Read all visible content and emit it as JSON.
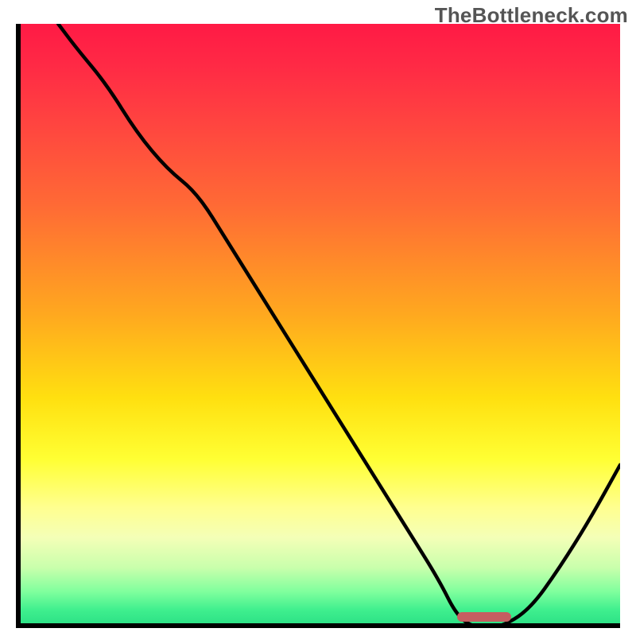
{
  "watermark": "TheBottleneck.com",
  "colors": {
    "axis": "#000000",
    "curve": "#000000",
    "optimum_marker": "#c65e61",
    "gradient_top": "#ff1a45",
    "gradient_mid": "#ffe010",
    "gradient_bottom": "#28de84"
  },
  "chart_data": {
    "type": "line",
    "title": "",
    "xlabel": "",
    "ylabel": "",
    "xlim": [
      0,
      100
    ],
    "ylim": [
      0,
      100
    ],
    "x": [
      7,
      10,
      15,
      20,
      25,
      30,
      35,
      40,
      45,
      50,
      55,
      60,
      65,
      70,
      73,
      76,
      80,
      85,
      90,
      95,
      100
    ],
    "values": [
      100,
      96,
      90,
      82,
      76,
      72,
      64,
      56,
      48,
      40,
      32,
      24,
      16,
      8,
      2,
      0,
      0,
      3,
      10,
      18,
      27
    ],
    "optimum_range_x": [
      73,
      82
    ],
    "optimum_value": 0,
    "note": "x is relative horizontal position (0=left axis,100=right edge); values are relative height above baseline (0=bottom axis,100=top)"
  }
}
